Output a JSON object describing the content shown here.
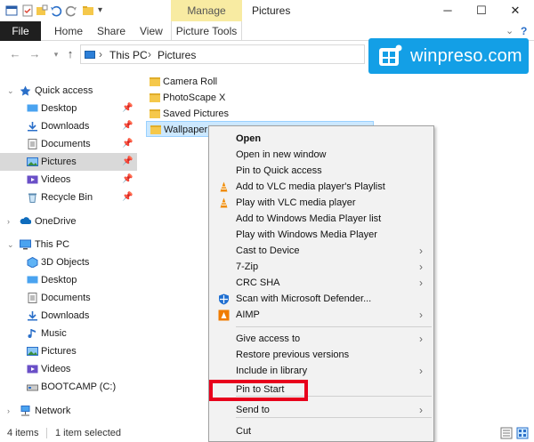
{
  "window": {
    "title": "Pictures",
    "context_tab": "Manage",
    "minimize": "─",
    "maximize": "☐",
    "close": "✕",
    "help_chevron": "⌄"
  },
  "ribbon": {
    "file": "File",
    "home": "Home",
    "share": "Share",
    "view": "View",
    "picture_tools": "Picture Tools",
    "help": "?"
  },
  "address": {
    "segments": [
      "This PC",
      "Pictures"
    ],
    "sep": "›"
  },
  "logo": {
    "text": "winpreso.com",
    "color": "#139fe6"
  },
  "nav": {
    "quick_access": "Quick access",
    "quick_items": [
      {
        "label": "Desktop",
        "icon": "desktop-icon"
      },
      {
        "label": "Downloads",
        "icon": "downloads-icon"
      },
      {
        "label": "Documents",
        "icon": "documents-icon"
      },
      {
        "label": "Pictures",
        "icon": "pictures-icon"
      },
      {
        "label": "Videos",
        "icon": "videos-icon"
      },
      {
        "label": "Recycle Bin",
        "icon": "recycle-bin-icon"
      }
    ],
    "onedrive": "OneDrive",
    "this_pc": "This PC",
    "pc_items": [
      {
        "label": "3D Objects"
      },
      {
        "label": "Desktop"
      },
      {
        "label": "Documents"
      },
      {
        "label": "Downloads"
      },
      {
        "label": "Music"
      },
      {
        "label": "Pictures"
      },
      {
        "label": "Videos"
      },
      {
        "label": "BOOTCAMP (C:)"
      }
    ],
    "network": "Network"
  },
  "files": [
    "Camera Roll",
    "PhotoScape X",
    "Saved Pictures",
    "Wallpaper"
  ],
  "context_menu": {
    "items": [
      {
        "label": "Open"
      },
      {
        "label": "Open in new window"
      },
      {
        "label": "Pin to Quick access"
      },
      {
        "label": "Add to VLC media player's Playlist"
      },
      {
        "label": "Play with VLC media player"
      },
      {
        "label": "Add to Windows Media Player list"
      },
      {
        "label": "Play with Windows Media Player"
      },
      {
        "label": "Cast to Device"
      },
      {
        "label": "7-Zip"
      },
      {
        "label": "CRC SHA"
      },
      {
        "label": "Scan with Microsoft Defender..."
      },
      {
        "label": "AIMP"
      },
      {
        "label": "Give access to"
      },
      {
        "label": "Restore previous versions"
      },
      {
        "label": "Include in library"
      },
      {
        "label": "Pin to Start"
      },
      {
        "label": "Send to"
      },
      {
        "label": "Cut"
      }
    ],
    "submenu_arrow": "›",
    "highlight_color": "#e8001c"
  },
  "status": {
    "items_count": "4 items",
    "selected": "1 item selected"
  }
}
